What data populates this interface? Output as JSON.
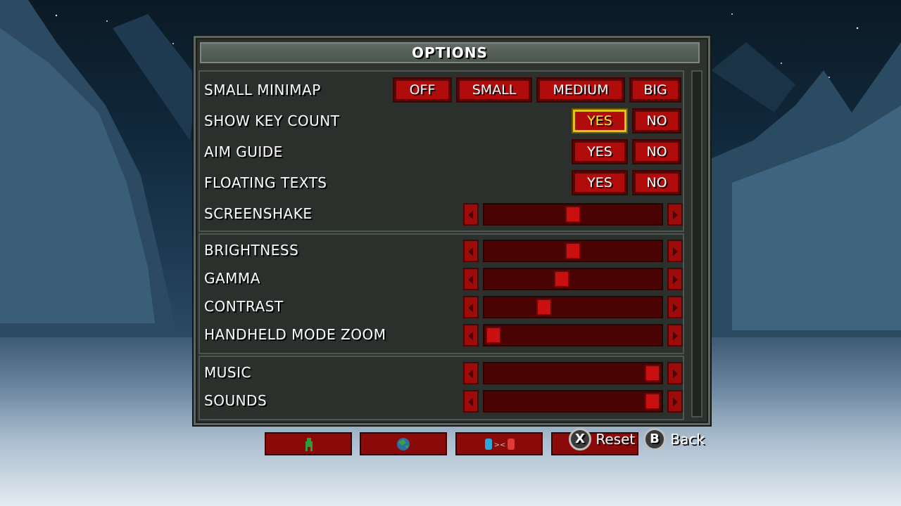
{
  "title": "OPTIONS",
  "colors": {
    "accent": "#b00c0c",
    "selected": "#e0c21a",
    "panel": "#2d322f"
  },
  "rows": {
    "minimap": {
      "label": "SMALL MINIMAP",
      "options": [
        "OFF",
        "SMALL",
        "MEDIUM",
        "BIG"
      ]
    },
    "keycount": {
      "label": "SHOW KEY COUNT",
      "options": [
        "YES",
        "NO"
      ],
      "selected": "YES"
    },
    "aim": {
      "label": "AIM GUIDE",
      "options": [
        "YES",
        "NO"
      ]
    },
    "floating": {
      "label": "FLOATING TEXTS",
      "options": [
        "YES",
        "NO"
      ]
    },
    "screenshake": {
      "label": "SCREENSHAKE",
      "value": 0.5
    },
    "brightness": {
      "label": "BRIGHTNESS",
      "value": 0.5
    },
    "gamma": {
      "label": "GAMMA",
      "value": 0.43
    },
    "contrast": {
      "label": "CONTRAST",
      "value": 0.32
    },
    "zoom": {
      "label": "HANDHELD MODE ZOOM",
      "value": 0.0
    },
    "music": {
      "label": "MUSIC",
      "value": 1.0
    },
    "sounds": {
      "label": "SOUNDS",
      "value": 1.0
    }
  },
  "tabs": [
    {
      "icon": "player-icon"
    },
    {
      "icon": "globe-icon"
    },
    {
      "icon": "controller-icon"
    },
    {
      "icon": "unknown-icon"
    }
  ],
  "hints": {
    "reset": {
      "button": "X",
      "label": "Reset"
    },
    "back": {
      "button": "B",
      "label": "Back"
    }
  }
}
